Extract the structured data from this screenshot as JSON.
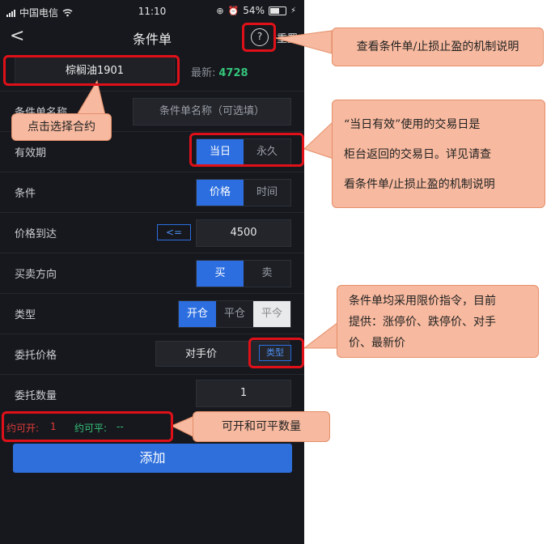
{
  "status": {
    "carrier": "中国电信",
    "time": "11:10",
    "battery": "54%"
  },
  "nav": {
    "title": "条件单",
    "back": "<",
    "help": "?",
    "reset": "重置"
  },
  "contract": {
    "name": "棕榈油1901",
    "latest_label": "最新:",
    "latest_value": "4728"
  },
  "form": {
    "name": {
      "label": "条件单名称",
      "placeholder": "条件单名称（可选填）"
    },
    "validity": {
      "label": "有效期",
      "options": [
        "当日",
        "永久"
      ]
    },
    "condition": {
      "label": "条件",
      "options": [
        "价格",
        "时间"
      ]
    },
    "price_reach": {
      "label": "价格到达",
      "operator": "<=",
      "value": "4500"
    },
    "direction": {
      "label": "买卖方向",
      "options": [
        "买",
        "卖"
      ]
    },
    "type": {
      "label": "类型",
      "options": [
        "开仓",
        "平仓",
        "平今"
      ]
    },
    "order_price": {
      "label": "委托价格",
      "value": "对手价",
      "type_btn": "类型"
    },
    "quantity": {
      "label": "委托数量",
      "value": "1"
    }
  },
  "availability": {
    "open_label": "约可开:",
    "open_value": "1",
    "close_label": "约可平:",
    "close_value": "--"
  },
  "add_button": "添加",
  "annotations": {
    "help": "查看条件单/止损止盈的机制说明",
    "contract": "点击选择合约",
    "validity_lines": [
      "“当日有效”使用的交易日是",
      "柜台返回的交易日。详见请查",
      "看条件单/止损止盈的机制说明"
    ],
    "order_price_lines": [
      "条件单均采用限价指令，目前",
      "提供：涨停价、跌停价、对手",
      "价、最新价"
    ],
    "quantity": "可开和可平数量"
  },
  "colors": {
    "accent": "#2c6ee0",
    "highlight": "#e01019",
    "callout": "#f7b99f",
    "up": "#35c47a",
    "avail_red": "#e23b3b"
  }
}
